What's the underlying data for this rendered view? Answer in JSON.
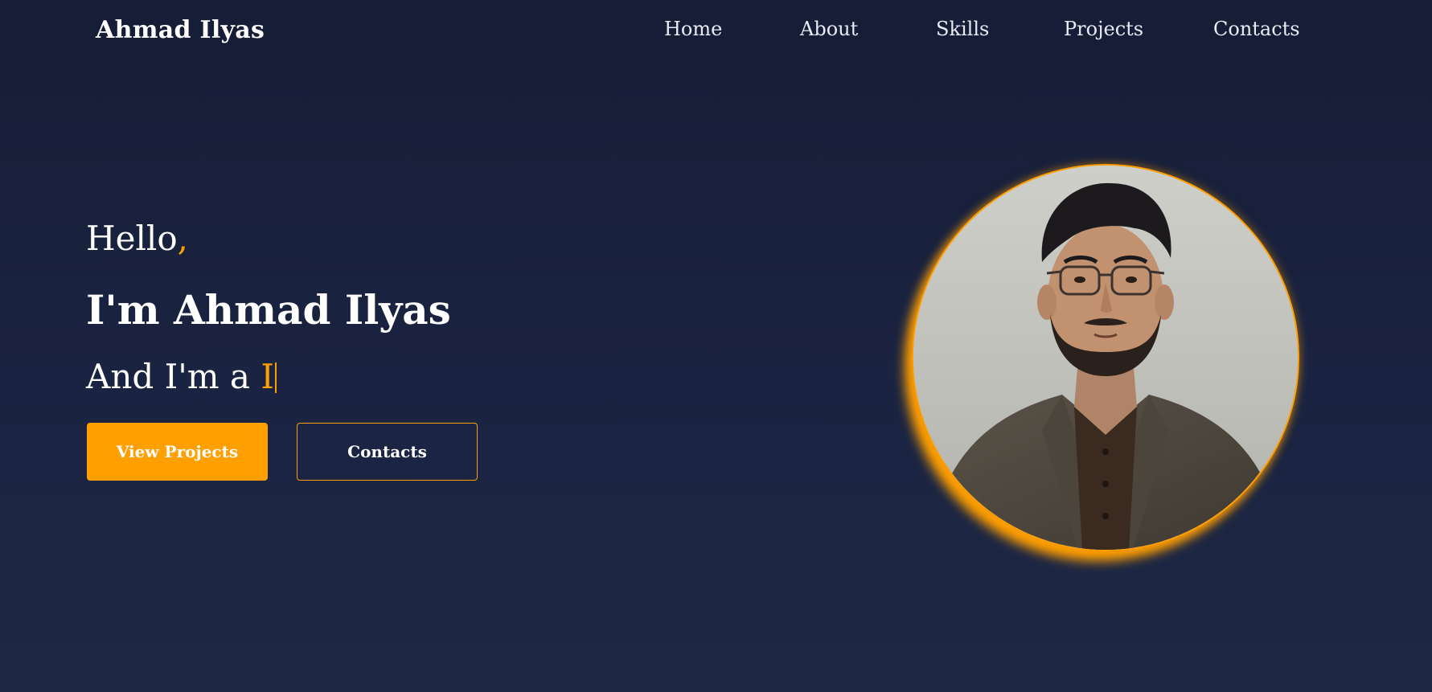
{
  "brand": {
    "name": "Ahmad Ilyas"
  },
  "nav": {
    "home": "Home",
    "about": "About",
    "skills": "Skills",
    "projects": "Projects",
    "contacts": "Contacts"
  },
  "hero": {
    "greeting": "Hello",
    "greeting_punct": ",",
    "name_line": "I'm Ahmad Ilyas",
    "role_prefix": "And I'm a ",
    "role_typed": "I"
  },
  "buttons": {
    "primary": "View Projects",
    "secondary": "Contacts"
  },
  "colors": {
    "accent": "#ff9f00",
    "background": "#1a2341",
    "text": "#ffffff"
  },
  "icons": {
    "cursor": "text-cursor-bar"
  }
}
